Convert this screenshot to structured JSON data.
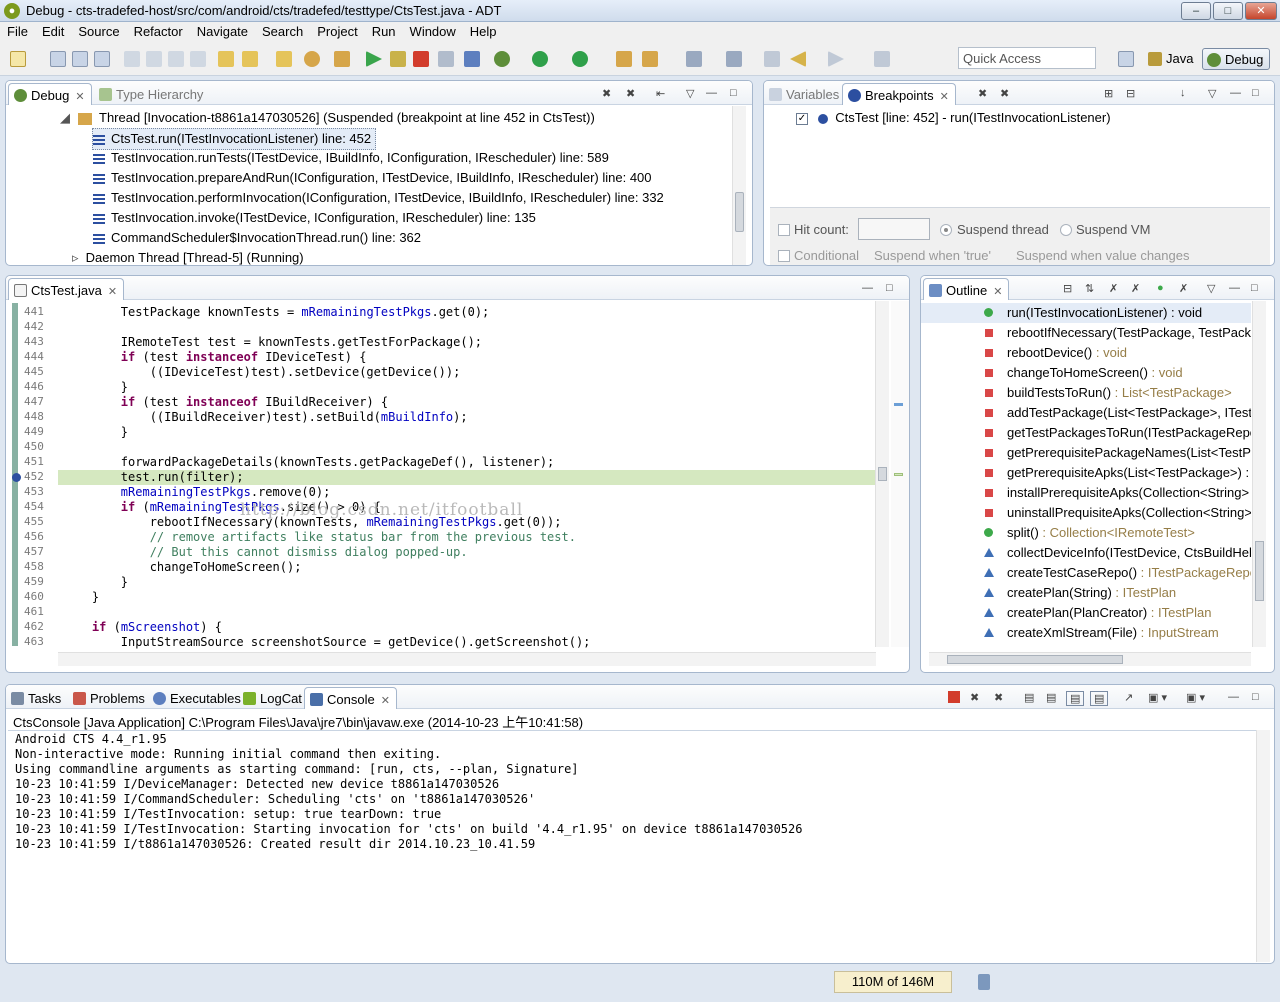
{
  "window": {
    "title": "Debug - cts-tradefed-host/src/com/android/cts/tradefed/testtype/CtsTest.java - ADT",
    "minimize": "–",
    "maximize": "□",
    "close": "✕"
  },
  "menu": [
    "File",
    "Edit",
    "Source",
    "Refactor",
    "Navigate",
    "Search",
    "Project",
    "Run",
    "Window",
    "Help"
  ],
  "quick_access": {
    "placeholder": "Quick Access"
  },
  "perspectives": {
    "java": "Java",
    "debug": "Debug"
  },
  "debug_view": {
    "tabs": {
      "debug": "Debug",
      "type_hierarchy": "Type Hierarchy"
    },
    "thread": "Thread [Invocation-t8861a147030526] (Suspended (breakpoint at line 452 in CtsTest))",
    "frames": [
      "CtsTest.run(ITestInvocationListener) line: 452",
      "TestInvocation.runTests(ITestDevice, IBuildInfo, IConfiguration, IRescheduler) line: 589",
      "TestInvocation.prepareAndRun(IConfiguration, ITestDevice, IBuildInfo, IRescheduler) line: 400",
      "TestInvocation.performInvocation(IConfiguration, ITestDevice, IBuildInfo, IRescheduler) line: 332",
      "TestInvocation.invoke(ITestDevice, IConfiguration, IRescheduler) line: 135",
      "CommandScheduler$InvocationThread.run() line: 362"
    ],
    "daemon": "Daemon Thread [Thread-5] (Running)"
  },
  "breakpoints_view": {
    "tabs": {
      "variables": "Variables",
      "breakpoints": "Breakpoints"
    },
    "entries": [
      "CtsTest [line: 452] - run(ITestInvocationListener)"
    ],
    "hit_count_label": "Hit count:",
    "suspend_thread": "Suspend thread",
    "suspend_vm": "Suspend VM",
    "conditional": "Conditional",
    "suspend_true": "Suspend when 'true'",
    "suspend_changes": "Suspend when value changes"
  },
  "editor": {
    "tab": "CtsTest.java",
    "current_line": 452,
    "watermark": "http://blog.csdn.net/itfootball",
    "lines": [
      {
        "n": "441",
        "code": [
          [
            "",
            "        TestPackage knownTests = "
          ],
          [
            "fld",
            "mRemainingTestPkgs"
          ],
          [
            "",
            ".get(0);"
          ]
        ]
      },
      {
        "n": "442",
        "code": [
          [
            "",
            ""
          ]
        ]
      },
      {
        "n": "443",
        "code": [
          [
            "",
            "        IRemoteTest test = knownTests.getTestForPackage();"
          ]
        ]
      },
      {
        "n": "444",
        "code": [
          [
            "",
            "        "
          ],
          [
            "kw",
            "if"
          ],
          [
            "",
            " (test "
          ],
          [
            "kw",
            "instanceof"
          ],
          [
            "",
            " IDeviceTest) {"
          ]
        ]
      },
      {
        "n": "445",
        "code": [
          [
            "",
            "            ((IDeviceTest)test).setDevice(getDevice());"
          ]
        ]
      },
      {
        "n": "446",
        "code": [
          [
            "",
            "        }"
          ]
        ]
      },
      {
        "n": "447",
        "code": [
          [
            "",
            "        "
          ],
          [
            "kw",
            "if"
          ],
          [
            "",
            " (test "
          ],
          [
            "kw",
            "instanceof"
          ],
          [
            "",
            " IBuildReceiver) {"
          ]
        ]
      },
      {
        "n": "448",
        "code": [
          [
            "",
            "            ((IBuildReceiver)test).setBuild("
          ],
          [
            "fld",
            "mBuildInfo"
          ],
          [
            "",
            ");"
          ]
        ]
      },
      {
        "n": "449",
        "code": [
          [
            "",
            "        }"
          ]
        ]
      },
      {
        "n": "450",
        "code": [
          [
            "",
            ""
          ]
        ]
      },
      {
        "n": "451",
        "code": [
          [
            "",
            "        forwardPackageDetails(knownTests.getPackageDef(), listener);"
          ]
        ]
      },
      {
        "n": "452",
        "code": [
          [
            "",
            "        test.run(filter);"
          ]
        ]
      },
      {
        "n": "453",
        "code": [
          [
            "",
            "        "
          ],
          [
            "fld",
            "mRemainingTestPkgs"
          ],
          [
            "",
            ".remove(0);"
          ]
        ]
      },
      {
        "n": "454",
        "code": [
          [
            "",
            "        "
          ],
          [
            "kw",
            "if"
          ],
          [
            "",
            " ("
          ],
          [
            "fld",
            "mRemainingTestPkgs"
          ],
          [
            "",
            ".size() > 0) {"
          ]
        ]
      },
      {
        "n": "455",
        "code": [
          [
            "",
            "            rebootIfNecessary(knownTests, "
          ],
          [
            "fld",
            "mRemainingTestPkgs"
          ],
          [
            "",
            ".get(0));"
          ]
        ]
      },
      {
        "n": "456",
        "code": [
          [
            "",
            "            "
          ],
          [
            "cm",
            "// remove artifacts like status bar from the previous test."
          ]
        ]
      },
      {
        "n": "457",
        "code": [
          [
            "",
            "            "
          ],
          [
            "cm",
            "// But this cannot dismiss dialog popped-up."
          ]
        ]
      },
      {
        "n": "458",
        "code": [
          [
            "",
            "            changeToHomeScreen();"
          ]
        ]
      },
      {
        "n": "459",
        "code": [
          [
            "",
            "        }"
          ]
        ]
      },
      {
        "n": "460",
        "code": [
          [
            "",
            "    }"
          ]
        ]
      },
      {
        "n": "461",
        "code": [
          [
            "",
            ""
          ]
        ]
      },
      {
        "n": "462",
        "code": [
          [
            "",
            "    "
          ],
          [
            "kw",
            "if"
          ],
          [
            "",
            " ("
          ],
          [
            "fld",
            "mScreenshot"
          ],
          [
            "",
            ") {"
          ]
        ]
      },
      {
        "n": "463",
        "code": [
          [
            "",
            "        InputStreamSource screenshotSource = getDevice().getScreenshot();"
          ]
        ]
      }
    ]
  },
  "outline": {
    "tab": "Outline",
    "items": [
      {
        "kind": "circle",
        "name": "run(ITestInvocationListener)",
        "type": " : void",
        "selected": true
      },
      {
        "kind": "square",
        "name": "rebootIfNecessary(TestPackage, TestPack",
        "type": ""
      },
      {
        "kind": "square",
        "name": "rebootDevice()",
        "type": " : void"
      },
      {
        "kind": "square",
        "name": "changeToHomeScreen()",
        "type": " : void"
      },
      {
        "kind": "square",
        "name": "buildTestsToRun()",
        "type": " : List<TestPackage>"
      },
      {
        "kind": "square",
        "name": "addTestPackage(List<TestPackage>, ITest",
        "type": ""
      },
      {
        "kind": "square",
        "name": "getTestPackagesToRun(ITestPackageRepo",
        "type": ""
      },
      {
        "kind": "square",
        "name": "getPrerequisitePackageNames(List<TestPa",
        "type": ""
      },
      {
        "kind": "square",
        "name": "getPrerequisiteApks(List<TestPackage>) :",
        "type": ""
      },
      {
        "kind": "square",
        "name": "installPrerequisiteApks(Collection<String>",
        "type": ""
      },
      {
        "kind": "square",
        "name": "uninstallPrequisiteApks(Collection<String>",
        "type": ""
      },
      {
        "kind": "circle",
        "name": "split()",
        "type": " : Collection<IRemoteTest>"
      },
      {
        "kind": "triangle",
        "name": "collectDeviceInfo(ITestDevice, CtsBuildHelp",
        "type": ""
      },
      {
        "kind": "triangle",
        "name": "createTestCaseRepo()",
        "type": " : ITestPackageRepo"
      },
      {
        "kind": "triangle",
        "name": "createPlan(String)",
        "type": " : ITestPlan"
      },
      {
        "kind": "triangle",
        "name": "createPlan(PlanCreator)",
        "type": " : ITestPlan"
      },
      {
        "kind": "triangle",
        "name": "createXmlStream(File)",
        "type": " : InputStream"
      }
    ]
  },
  "console_view": {
    "tabs": [
      "Tasks",
      "Problems",
      "Executables",
      "LogCat",
      "Console"
    ],
    "process": "CtsConsole [Java Application] C:\\Program Files\\Java\\jre7\\bin\\javaw.exe (2014-10-23 上午10:41:58)",
    "lines": [
      "Android CTS 4.4_r1.95",
      "Non-interactive mode: Running initial command then exiting.",
      "Using commandline arguments as starting command: [run, cts, --plan, Signature]",
      "10-23 10:41:59 I/DeviceManager: Detected new device t8861a147030526",
      "10-23 10:41:59 I/CommandScheduler: Scheduling 'cts' on 't8861a147030526'",
      "10-23 10:41:59 I/TestInvocation: setup: true tearDown: true",
      "10-23 10:41:59 I/TestInvocation: Starting invocation for 'cts' on build '4.4_r1.95' on device t8861a147030526",
      "10-23 10:41:59 I/t8861a147030526: Created result dir 2014.10.23_10.41.59"
    ]
  },
  "status": {
    "heap": "110M of 146M"
  },
  "colors": {
    "current_line": "#d5e8c0",
    "accent": "#3a6ea5"
  }
}
